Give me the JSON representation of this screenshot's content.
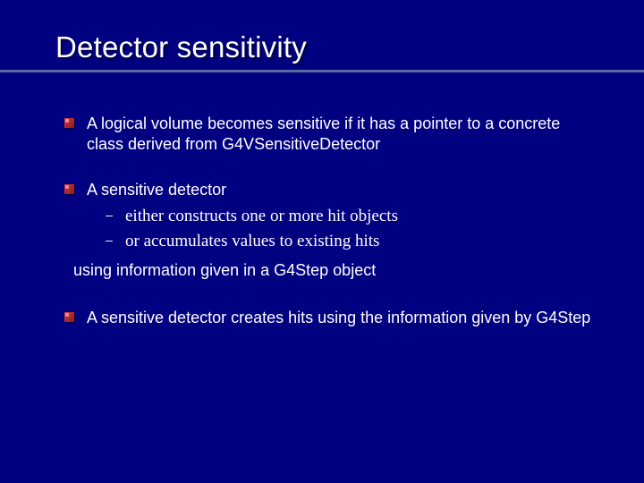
{
  "title": "Detector sensitivity",
  "bullets": [
    {
      "text": "A logical volume becomes sensitive if it has a pointer to a concrete class derived from G4VSensitiveDetector"
    },
    {
      "text": "A sensitive detector",
      "subitems": [
        "either constructs one or more hit objects",
        "or accumulates values to existing hits"
      ],
      "continuation": "using information given in a G4Step object"
    },
    {
      "text": "A sensitive detector creates hits using the information given by G4Step"
    }
  ]
}
